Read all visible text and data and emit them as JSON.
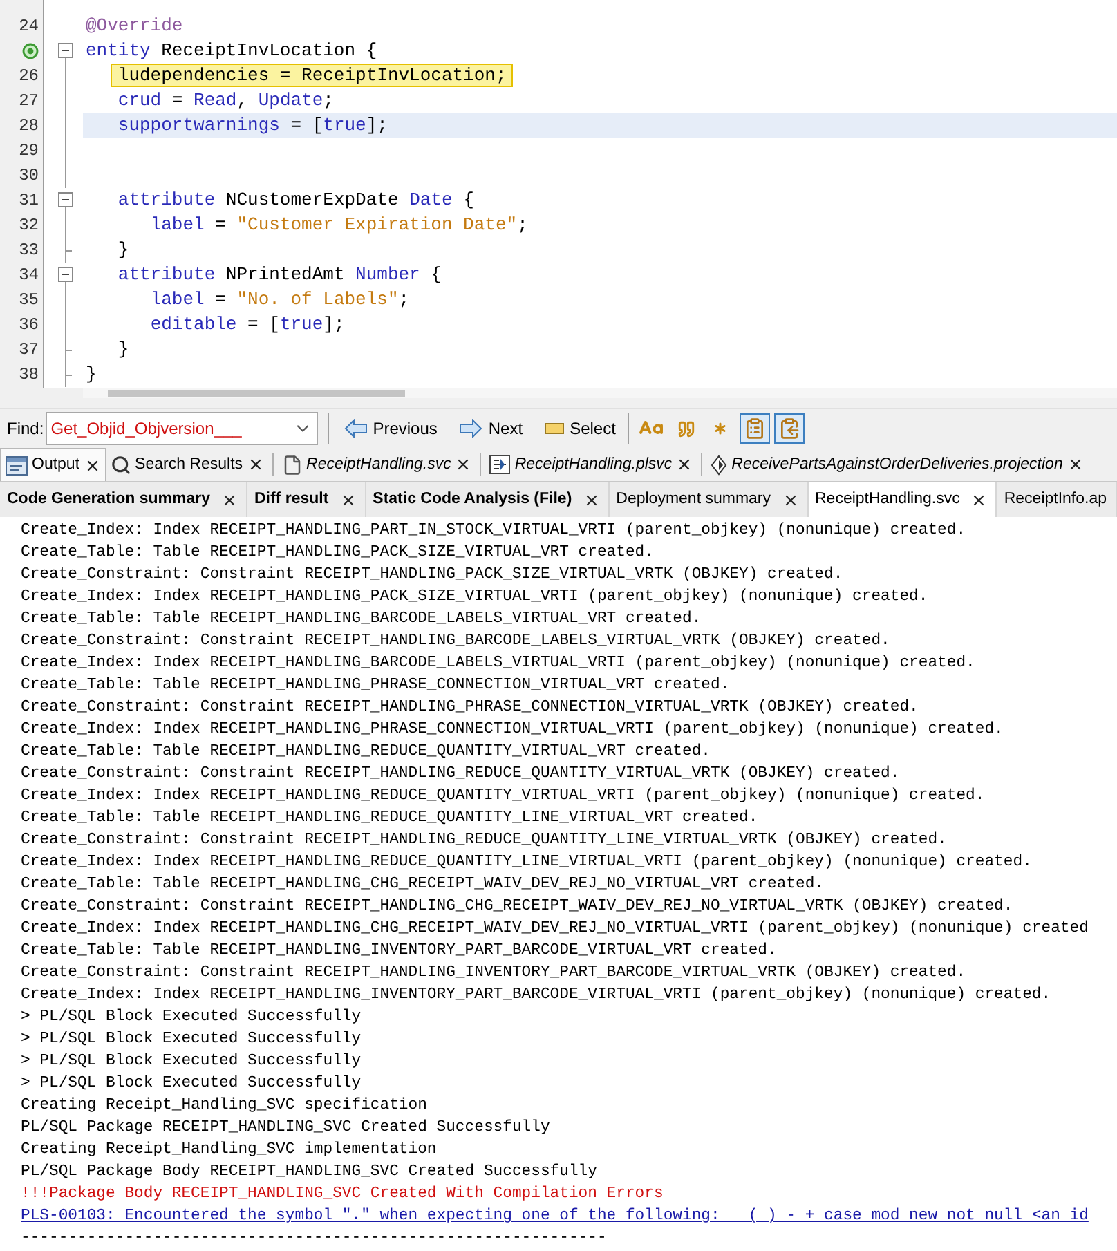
{
  "editor": {
    "lines": [
      {
        "number": "24",
        "override_marker": false,
        "collapsible": false,
        "block_end": false,
        "current": false,
        "search_match": false,
        "tokens": [
          {
            "kind": "annotation",
            "text": "@Override"
          }
        ]
      },
      {
        "override_marker": true,
        "collapsible": true,
        "block_end": false,
        "current": false,
        "search_match": false,
        "tokens": [
          {
            "kind": "keyword",
            "text": "entity"
          },
          {
            "kind": "plain",
            "text": " ReceiptInvLocation {"
          }
        ]
      },
      {
        "number": "26",
        "override_marker": false,
        "collapsible": false,
        "block_end": false,
        "current": false,
        "search_match": true,
        "tokens": [
          {
            "kind": "plain",
            "text": "   ludependencies = ReceiptInvLocation;"
          }
        ]
      },
      {
        "number": "27",
        "override_marker": false,
        "collapsible": false,
        "block_end": false,
        "current": false,
        "search_match": false,
        "tokens": [
          {
            "kind": "keyword",
            "text": "   crud"
          },
          {
            "kind": "plain",
            "text": " = "
          },
          {
            "kind": "keyword",
            "text": "Read"
          },
          {
            "kind": "plain",
            "text": ", "
          },
          {
            "kind": "keyword",
            "text": "Update"
          },
          {
            "kind": "plain",
            "text": ";"
          }
        ]
      },
      {
        "number": "28",
        "override_marker": false,
        "collapsible": false,
        "block_end": false,
        "current": true,
        "search_match": false,
        "tokens": [
          {
            "kind": "keyword",
            "text": "   supportwarnings"
          },
          {
            "kind": "plain",
            "text": " = ["
          },
          {
            "kind": "keyword",
            "text": "true"
          },
          {
            "kind": "plain",
            "text": "];"
          }
        ]
      },
      {
        "number": "29",
        "override_marker": false,
        "collapsible": false,
        "block_end": false,
        "current": false
      },
      {
        "number": "30",
        "override_marker": false,
        "collapsible": false,
        "block_end": false,
        "current": false
      },
      {
        "number": "31",
        "override_marker": false,
        "collapsible": true,
        "block_end": false,
        "current": false,
        "search_match": false,
        "tokens": [
          {
            "kind": "keyword",
            "text": "   attribute"
          },
          {
            "kind": "plain",
            "text": " NCustomerExpDate "
          },
          {
            "kind": "keyword",
            "text": "Date"
          },
          {
            "kind": "plain",
            "text": " {"
          }
        ]
      },
      {
        "number": "32",
        "override_marker": false,
        "collapsible": false,
        "block_end": false,
        "current": false,
        "search_match": false,
        "tokens": [
          {
            "kind": "keyword",
            "text": "      label"
          },
          {
            "kind": "plain",
            "text": " = "
          },
          {
            "kind": "string",
            "text": "\"Customer Expiration Date\""
          },
          {
            "kind": "plain",
            "text": ";"
          }
        ]
      },
      {
        "number": "33",
        "override_marker": false,
        "collapsible": false,
        "block_end": true,
        "current": false,
        "search_match": false,
        "tokens": [
          {
            "kind": "plain",
            "text": "   }"
          }
        ]
      },
      {
        "number": "34",
        "override_marker": false,
        "collapsible": true,
        "block_end": false,
        "current": false,
        "search_match": false,
        "tokens": [
          {
            "kind": "keyword",
            "text": "   attribute"
          },
          {
            "kind": "plain",
            "text": " NPrintedAmt "
          },
          {
            "kind": "keyword",
            "text": "Number"
          },
          {
            "kind": "plain",
            "text": " {"
          }
        ]
      },
      {
        "number": "35",
        "override_marker": false,
        "collapsible": false,
        "block_end": false,
        "current": false,
        "search_match": false,
        "tokens": [
          {
            "kind": "keyword",
            "text": "      label"
          },
          {
            "kind": "plain",
            "text": " = "
          },
          {
            "kind": "string",
            "text": "\"No. of Labels\""
          },
          {
            "kind": "plain",
            "text": ";"
          }
        ]
      },
      {
        "number": "36",
        "override_marker": false,
        "collapsible": false,
        "block_end": false,
        "current": false,
        "search_match": false,
        "tokens": [
          {
            "kind": "keyword",
            "text": "      editable"
          },
          {
            "kind": "plain",
            "text": " = ["
          },
          {
            "kind": "keyword",
            "text": "true"
          },
          {
            "kind": "plain",
            "text": "];"
          }
        ]
      },
      {
        "number": "37",
        "override_marker": false,
        "collapsible": false,
        "block_end": true,
        "current": false,
        "search_match": false,
        "tokens": [
          {
            "kind": "plain",
            "text": "   }"
          }
        ]
      },
      {
        "number": "38",
        "override_marker": false,
        "collapsible": false,
        "block_end": true,
        "current": false,
        "search_match": false,
        "tokens": [
          {
            "kind": "plain",
            "text": "}"
          }
        ]
      }
    ]
  },
  "find_bar": {
    "label": "Find:",
    "value": "Get_Objid_Objversion___",
    "buttons": [
      {
        "kind": "previous",
        "label": "Previous"
      },
      {
        "kind": "next",
        "label": "Next"
      },
      {
        "kind": "select",
        "label": "Select"
      }
    ],
    "toggles": [
      {
        "kind": "match_case",
        "selected": false
      },
      {
        "kind": "whole_words",
        "selected": false
      },
      {
        "kind": "regex",
        "selected": false
      },
      {
        "kind": "highlight",
        "selected": true
      },
      {
        "kind": "wrap",
        "selected": true
      }
    ]
  },
  "output_tabs": [
    {
      "label": "Output",
      "kind": "output",
      "selected": true
    },
    {
      "label": "Search Results",
      "kind": "search",
      "selected": false
    },
    {
      "label": "ReceiptHandling.svc",
      "kind": "svc",
      "selected": false
    },
    {
      "label": "ReceiptHandling.plsvc",
      "kind": "plsvc",
      "selected": false
    },
    {
      "label": "ReceivePartsAgainstOrderDeliveries.projection",
      "kind": "projection",
      "selected": false
    }
  ],
  "result_tabs": [
    {
      "label": "Code Generation summary",
      "unread": true,
      "selected": false,
      "closable": true
    },
    {
      "label": "Diff result",
      "unread": true,
      "selected": false,
      "closable": true
    },
    {
      "label": "Static Code Analysis (File)",
      "unread": true,
      "selected": false,
      "closable": true
    },
    {
      "label": "Deployment summary",
      "unread": false,
      "selected": false,
      "closable": true
    },
    {
      "label": "ReceiptHandling.svc",
      "unread": false,
      "selected": true,
      "closable": true
    },
    {
      "label": "ReceiptInfo.ap",
      "unread": false,
      "selected": false,
      "closable": false
    }
  ],
  "output_lines": [
    {
      "kind": "info",
      "text": "Create_Index: Index RECEIPT_HANDLING_PART_IN_STOCK_VIRTUAL_VRTI (parent_objkey) (nonunique) created."
    },
    {
      "kind": "info",
      "text": "Create_Table: Table RECEIPT_HANDLING_PACK_SIZE_VIRTUAL_VRT created."
    },
    {
      "kind": "info",
      "text": "Create_Constraint: Constraint RECEIPT_HANDLING_PACK_SIZE_VIRTUAL_VRTK (OBJKEY) created."
    },
    {
      "kind": "info",
      "text": "Create_Index: Index RECEIPT_HANDLING_PACK_SIZE_VIRTUAL_VRTI (parent_objkey) (nonunique) created."
    },
    {
      "kind": "info",
      "text": "Create_Table: Table RECEIPT_HANDLING_BARCODE_LABELS_VIRTUAL_VRT created."
    },
    {
      "kind": "info",
      "text": "Create_Constraint: Constraint RECEIPT_HANDLING_BARCODE_LABELS_VIRTUAL_VRTK (OBJKEY) created."
    },
    {
      "kind": "info",
      "text": "Create_Index: Index RECEIPT_HANDLING_BARCODE_LABELS_VIRTUAL_VRTI (parent_objkey) (nonunique) created."
    },
    {
      "kind": "info",
      "text": "Create_Table: Table RECEIPT_HANDLING_PHRASE_CONNECTION_VIRTUAL_VRT created."
    },
    {
      "kind": "info",
      "text": "Create_Constraint: Constraint RECEIPT_HANDLING_PHRASE_CONNECTION_VIRTUAL_VRTK (OBJKEY) created."
    },
    {
      "kind": "info",
      "text": "Create_Index: Index RECEIPT_HANDLING_PHRASE_CONNECTION_VIRTUAL_VRTI (parent_objkey) (nonunique) created."
    },
    {
      "kind": "info",
      "text": "Create_Table: Table RECEIPT_HANDLING_REDUCE_QUANTITY_VIRTUAL_VRT created."
    },
    {
      "kind": "info",
      "text": "Create_Constraint: Constraint RECEIPT_HANDLING_REDUCE_QUANTITY_VIRTUAL_VRTK (OBJKEY) created."
    },
    {
      "kind": "info",
      "text": "Create_Index: Index RECEIPT_HANDLING_REDUCE_QUANTITY_VIRTUAL_VRTI (parent_objkey) (nonunique) created."
    },
    {
      "kind": "info",
      "text": "Create_Table: Table RECEIPT_HANDLING_REDUCE_QUANTITY_LINE_VIRTUAL_VRT created."
    },
    {
      "kind": "info",
      "text": "Create_Constraint: Constraint RECEIPT_HANDLING_REDUCE_QUANTITY_LINE_VIRTUAL_VRTK (OBJKEY) created."
    },
    {
      "kind": "info",
      "text": "Create_Index: Index RECEIPT_HANDLING_REDUCE_QUANTITY_LINE_VIRTUAL_VRTI (parent_objkey) (nonunique) created."
    },
    {
      "kind": "info",
      "text": "Create_Table: Table RECEIPT_HANDLING_CHG_RECEIPT_WAIV_DEV_REJ_NO_VIRTUAL_VRT created."
    },
    {
      "kind": "info",
      "text": "Create_Constraint: Constraint RECEIPT_HANDLING_CHG_RECEIPT_WAIV_DEV_REJ_NO_VIRTUAL_VRTK (OBJKEY) created."
    },
    {
      "kind": "info",
      "text": "Create_Index: Index RECEIPT_HANDLING_CHG_RECEIPT_WAIV_DEV_REJ_NO_VIRTUAL_VRTI (parent_objkey) (nonunique) created"
    },
    {
      "kind": "info",
      "text": "Create_Table: Table RECEIPT_HANDLING_INVENTORY_PART_BARCODE_VIRTUAL_VRT created."
    },
    {
      "kind": "info",
      "text": "Create_Constraint: Constraint RECEIPT_HANDLING_INVENTORY_PART_BARCODE_VIRTUAL_VRTK (OBJKEY) created."
    },
    {
      "kind": "info",
      "text": "Create_Index: Index RECEIPT_HANDLING_INVENTORY_PART_BARCODE_VIRTUAL_VRTI (parent_objkey) (nonunique) created."
    },
    {
      "kind": "info",
      "text": "> PL/SQL Block Executed Successfully"
    },
    {
      "kind": "info",
      "text": "> PL/SQL Block Executed Successfully"
    },
    {
      "kind": "info",
      "text": "> PL/SQL Block Executed Successfully"
    },
    {
      "kind": "info",
      "text": "> PL/SQL Block Executed Successfully"
    },
    {
      "kind": "info",
      "text": "Creating Receipt_Handling_SVC specification"
    },
    {
      "kind": "info",
      "text": "PL/SQL Package RECEIPT_HANDLING_SVC Created Successfully"
    },
    {
      "kind": "info",
      "text": "Creating Receipt_Handling_SVC implementation"
    },
    {
      "kind": "info",
      "text": "PL/SQL Package Body RECEIPT_HANDLING_SVC Created Successfully"
    },
    {
      "kind": "error",
      "text": "!!!Package Body RECEIPT_HANDLING_SVC Created With Compilation Errors"
    },
    {
      "kind": "link",
      "text": "PLS-00103: Encountered the symbol \".\" when expecting one of the following:   ( ) - + case mod new not null <an id"
    },
    {
      "kind": "info",
      "text": "--------------------------------------------------------------"
    }
  ]
}
